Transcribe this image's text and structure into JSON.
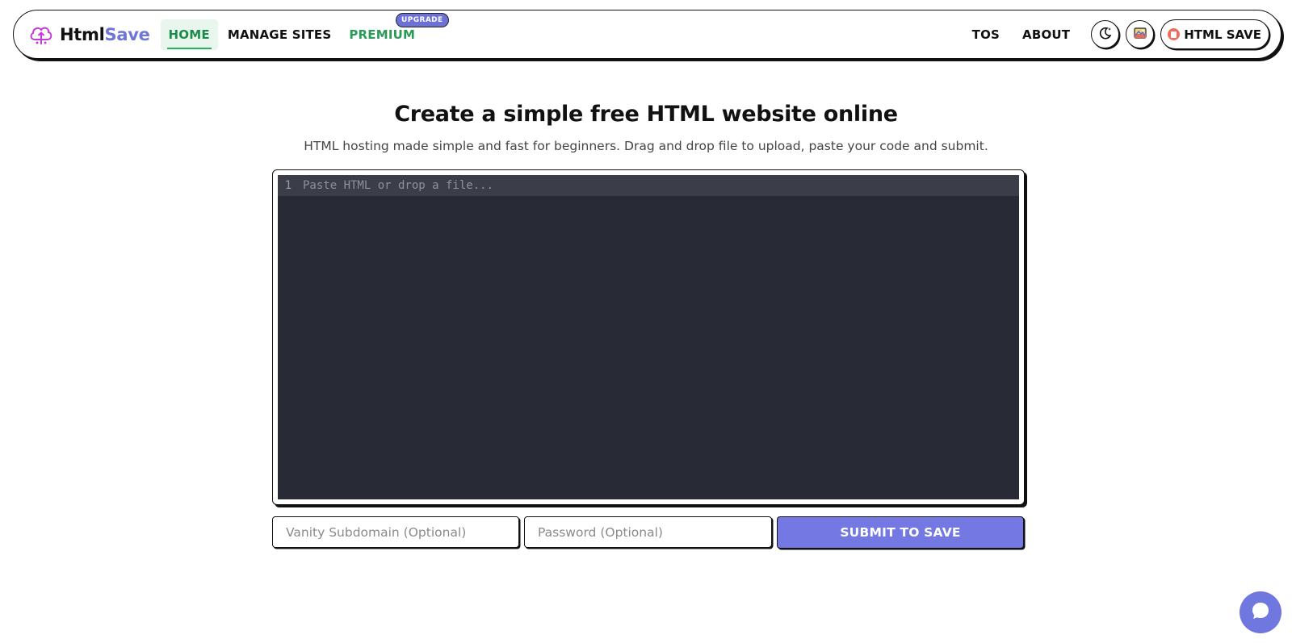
{
  "navbar": {
    "brand_part1": "Html",
    "brand_part2": "Save",
    "brand_color": "#6f75d8",
    "logo_icon": "cloud-upload-icon",
    "links": [
      {
        "label": "HOME",
        "active": true
      },
      {
        "label": "MANAGE SITES"
      },
      {
        "label": "PREMIUM",
        "color": "#2a9a57"
      }
    ],
    "upgrade_badge": "UPGRADE",
    "right_links": [
      "TOS",
      "ABOUT"
    ],
    "theme_icon": "moon-star-icon",
    "gallery_icon": "image-gallery-icon",
    "save_button_icon": "save-icon",
    "save_button": "HTML SAVE"
  },
  "main": {
    "title": "Create a simple free HTML website online",
    "subtitle": "HTML hosting made simple and fast for beginners. Drag and drop file to upload, paste your code and submit."
  },
  "editor": {
    "line_number": "1",
    "placeholder": "Paste HTML or drop a file...",
    "background": "#282a36"
  },
  "form": {
    "subdomain_placeholder": "Vanity Subdomain (Optional)",
    "password_placeholder": "Password (Optional)",
    "submit_label": "SUBMIT TO SAVE",
    "submit_color": "#7478e2"
  },
  "chat": {
    "icon": "chat-bubble-icon"
  }
}
